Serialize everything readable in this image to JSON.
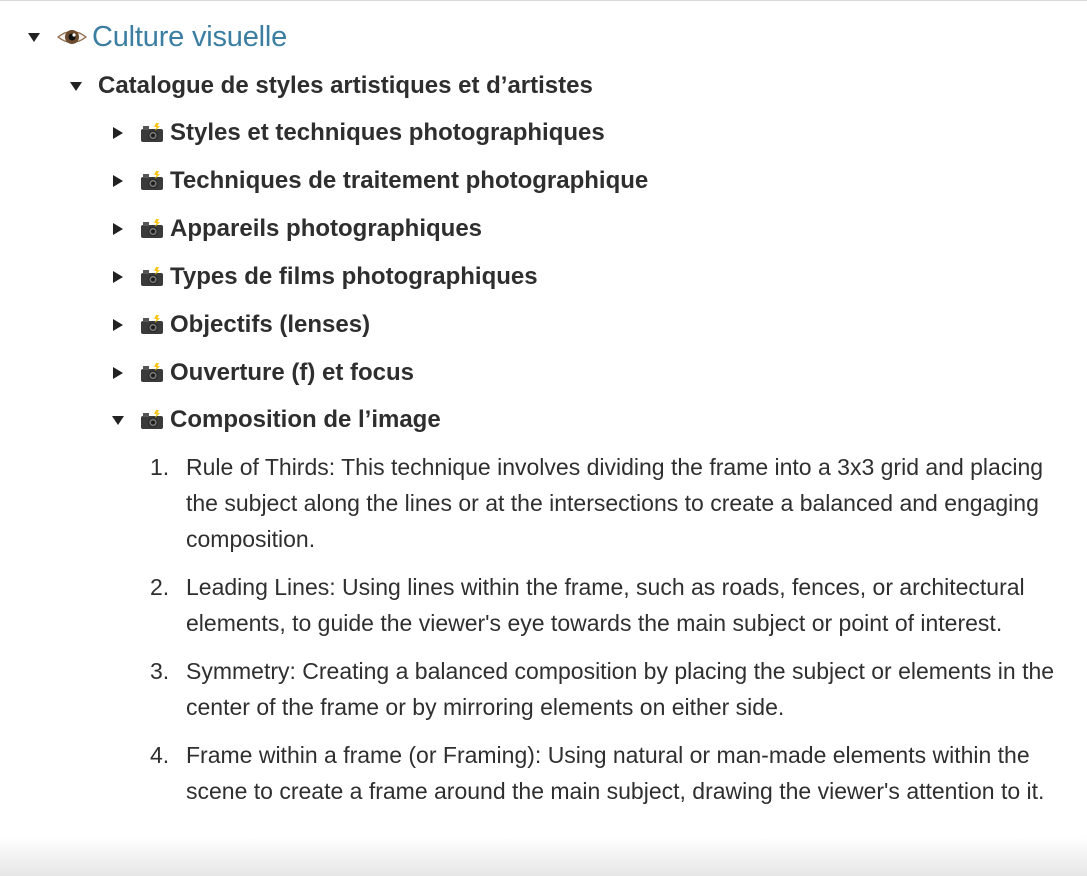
{
  "tree": {
    "root": {
      "title": "Culture visuelle",
      "icon": "eye-icon",
      "expanded": true
    },
    "catalogue": {
      "title": "Catalogue de styles artistiques et d’artistes",
      "expanded": true
    },
    "sections": [
      {
        "label": "Styles et techniques photographiques",
        "icon": "camera-flash-icon",
        "expanded": false
      },
      {
        "label": "Techniques de traitement photographique",
        "icon": "camera-flash-icon",
        "expanded": false
      },
      {
        "label": "Appareils photographiques",
        "icon": "camera-flash-icon",
        "expanded": false
      },
      {
        "label": "Types de films photographiques",
        "icon": "camera-flash-icon",
        "expanded": false
      },
      {
        "label": "Objectifs (lenses)",
        "icon": "camera-flash-icon",
        "expanded": false
      },
      {
        "label": "Ouverture (f) et focus",
        "icon": "camera-flash-icon",
        "expanded": false
      },
      {
        "label": "Composition de l’image",
        "icon": "camera-flash-icon",
        "expanded": true
      }
    ],
    "composition_items": [
      {
        "number": "1.",
        "text": "Rule of Thirds: This technique involves dividing the frame into a 3x3 grid and placing the subject along the lines or at the intersections to create a balanced and engaging composition."
      },
      {
        "number": "2.",
        "text": "Leading Lines: Using lines within the frame, such as roads, fences, or architectural elements, to guide the viewer's eye towards the main subject or point of interest."
      },
      {
        "number": "3.",
        "text": "Symmetry: Creating a balanced composition by placing the subject or elements in the center of the frame or by mirroring elements on either side."
      },
      {
        "number": "4.",
        "text": "Frame within a frame (or Framing): Using natural or man-made elements within the scene to create a frame around the main subject, drawing the viewer's attention to it."
      }
    ]
  },
  "colors": {
    "title": "#3b7ea1",
    "text": "#2e2e2e",
    "toggle": "#222222"
  }
}
